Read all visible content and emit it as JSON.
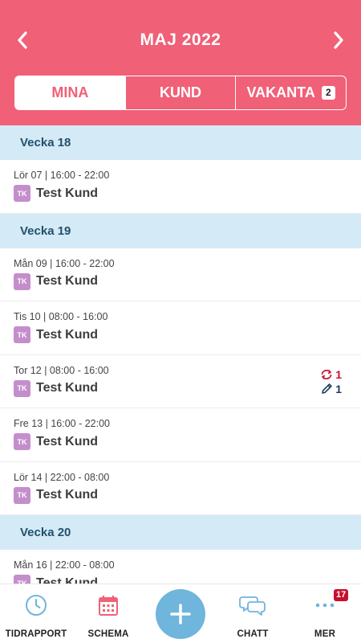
{
  "header": {
    "title": "MAJ 2022",
    "prev_icon": "chevron-left-icon",
    "next_icon": "chevron-right-icon"
  },
  "tabs": [
    {
      "label": "MINA",
      "active": true
    },
    {
      "label": "KUND",
      "active": false
    },
    {
      "label": "VAKANTA",
      "badge": "2",
      "active": false
    }
  ],
  "schedule": [
    {
      "week": "Vecka 18",
      "shifts": [
        {
          "time": "Lör 07 | 16:00 - 22:00",
          "initials": "TK",
          "client": "Test Kund"
        }
      ]
    },
    {
      "week": "Vecka 19",
      "shifts": [
        {
          "time": "Mån 09 | 16:00 - 22:00",
          "initials": "TK",
          "client": "Test Kund"
        },
        {
          "time": "Tis 10 | 08:00 - 16:00",
          "initials": "TK",
          "client": "Test Kund"
        },
        {
          "time": "Tor 12 | 08:00 - 16:00",
          "initials": "TK",
          "client": "Test Kund",
          "swap_count": "1",
          "edit_count": "1"
        },
        {
          "time": "Fre 13 | 16:00 - 22:00",
          "initials": "TK",
          "client": "Test Kund"
        },
        {
          "time": "Lör 14 | 22:00 - 08:00",
          "initials": "TK",
          "client": "Test Kund"
        }
      ]
    },
    {
      "week": "Vecka 20",
      "shifts": [
        {
          "time": "Mån 16 | 22:00 - 08:00",
          "initials": "TK",
          "client": "Test Kund"
        }
      ]
    }
  ],
  "tabbar": {
    "items": [
      {
        "label": "TIDRAPPORT",
        "icon": "clock-icon"
      },
      {
        "label": "SCHEMA",
        "icon": "calendar-icon"
      },
      {
        "label": "",
        "icon": "plus-icon"
      },
      {
        "label": "CHATT",
        "icon": "chat-bubbles-icon"
      },
      {
        "label": "MER",
        "icon": "more-dots-icon",
        "badge": "17"
      }
    ]
  },
  "colors": {
    "brand": "#f06077",
    "week_header": "#d4ebf7",
    "client_tag": "#c48ecc",
    "fab": "#6fb5dc",
    "alert": "#c8102e"
  }
}
